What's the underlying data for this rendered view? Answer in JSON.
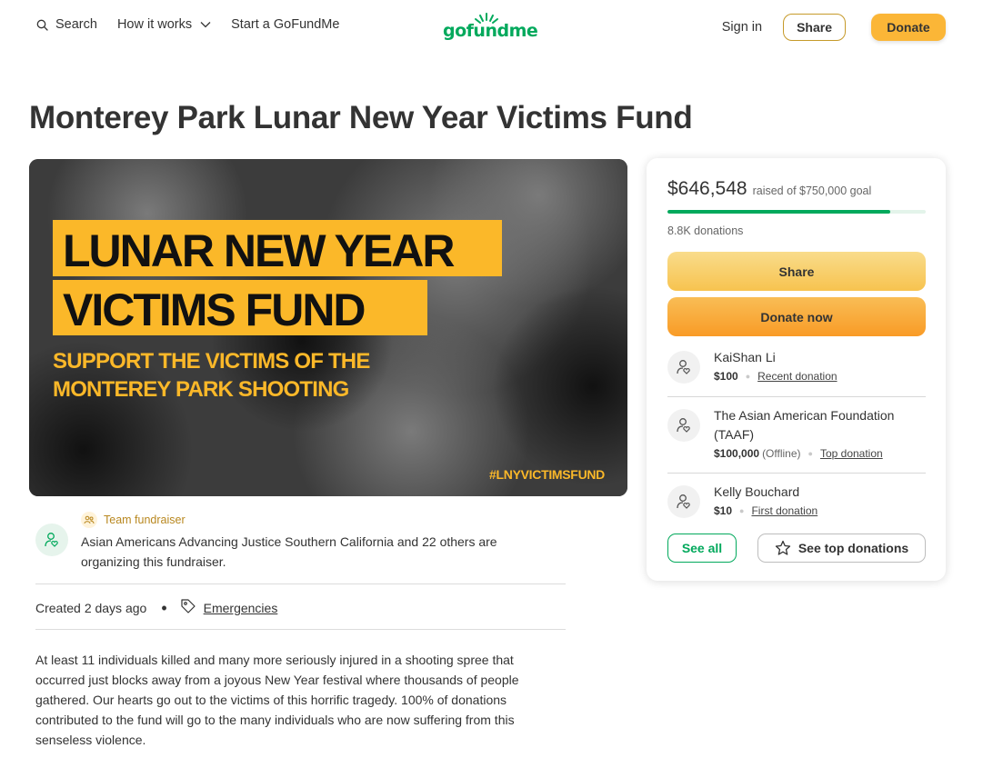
{
  "header": {
    "search_label": "Search",
    "how_it_works_label": "How it works",
    "start_label": "Start a GoFundMe",
    "logo_text": "gofundme",
    "signin_label": "Sign in",
    "share_label": "Share",
    "donate_label": "Donate"
  },
  "page": {
    "title": "Monterey Park Lunar New Year Victims Fund"
  },
  "hero": {
    "line1": "LUNAR NEW YEAR",
    "line2": "VICTIMS FUND",
    "sub1": "SUPPORT THE VICTIMS OF THE",
    "sub2": "MONTEREY PARK SHOOTING",
    "hashtag": "#LNYVICTIMSFUND"
  },
  "organizer": {
    "team_label": "Team fundraiser",
    "text": "Asian Americans Advancing Justice Southern California and 22 others are organizing this fundraiser."
  },
  "meta": {
    "created_prefix": "Created",
    "created_value": "2 days ago",
    "category": "Emergencies"
  },
  "story": {
    "text": "At least 11 individuals killed and many more seriously injured in a shooting spree that occurred just blocks away from a joyous New Year festival where thousands of people gathered. Our hearts go out to the victims of this horrific tragedy. 100% of donations contributed to the fund will go to the many individuals who are now suffering from this senseless violence."
  },
  "card": {
    "raised_amount": "$646,548",
    "raised_goal": "raised of $750,000 goal",
    "progress_fraction": 0.862,
    "donations_count": "8.8K donations",
    "share_label": "Share",
    "donate_now_label": "Donate now",
    "donors": [
      {
        "name": "KaiShan Li",
        "amount": "$100",
        "note": "",
        "tag": "Recent donation"
      },
      {
        "name": "The Asian American Foundation (TAAF)",
        "amount": "$100,000",
        "note": "(Offline)",
        "tag": "Top donation"
      },
      {
        "name": "Kelly Bouchard",
        "amount": "$10",
        "note": "",
        "tag": "First donation"
      }
    ],
    "see_all_label": "See all",
    "see_top_label": "See top donations"
  },
  "colors": {
    "brand_green": "#02a95c",
    "donate_orange": "#fbb637",
    "banner_yellow": "#fbb829"
  }
}
